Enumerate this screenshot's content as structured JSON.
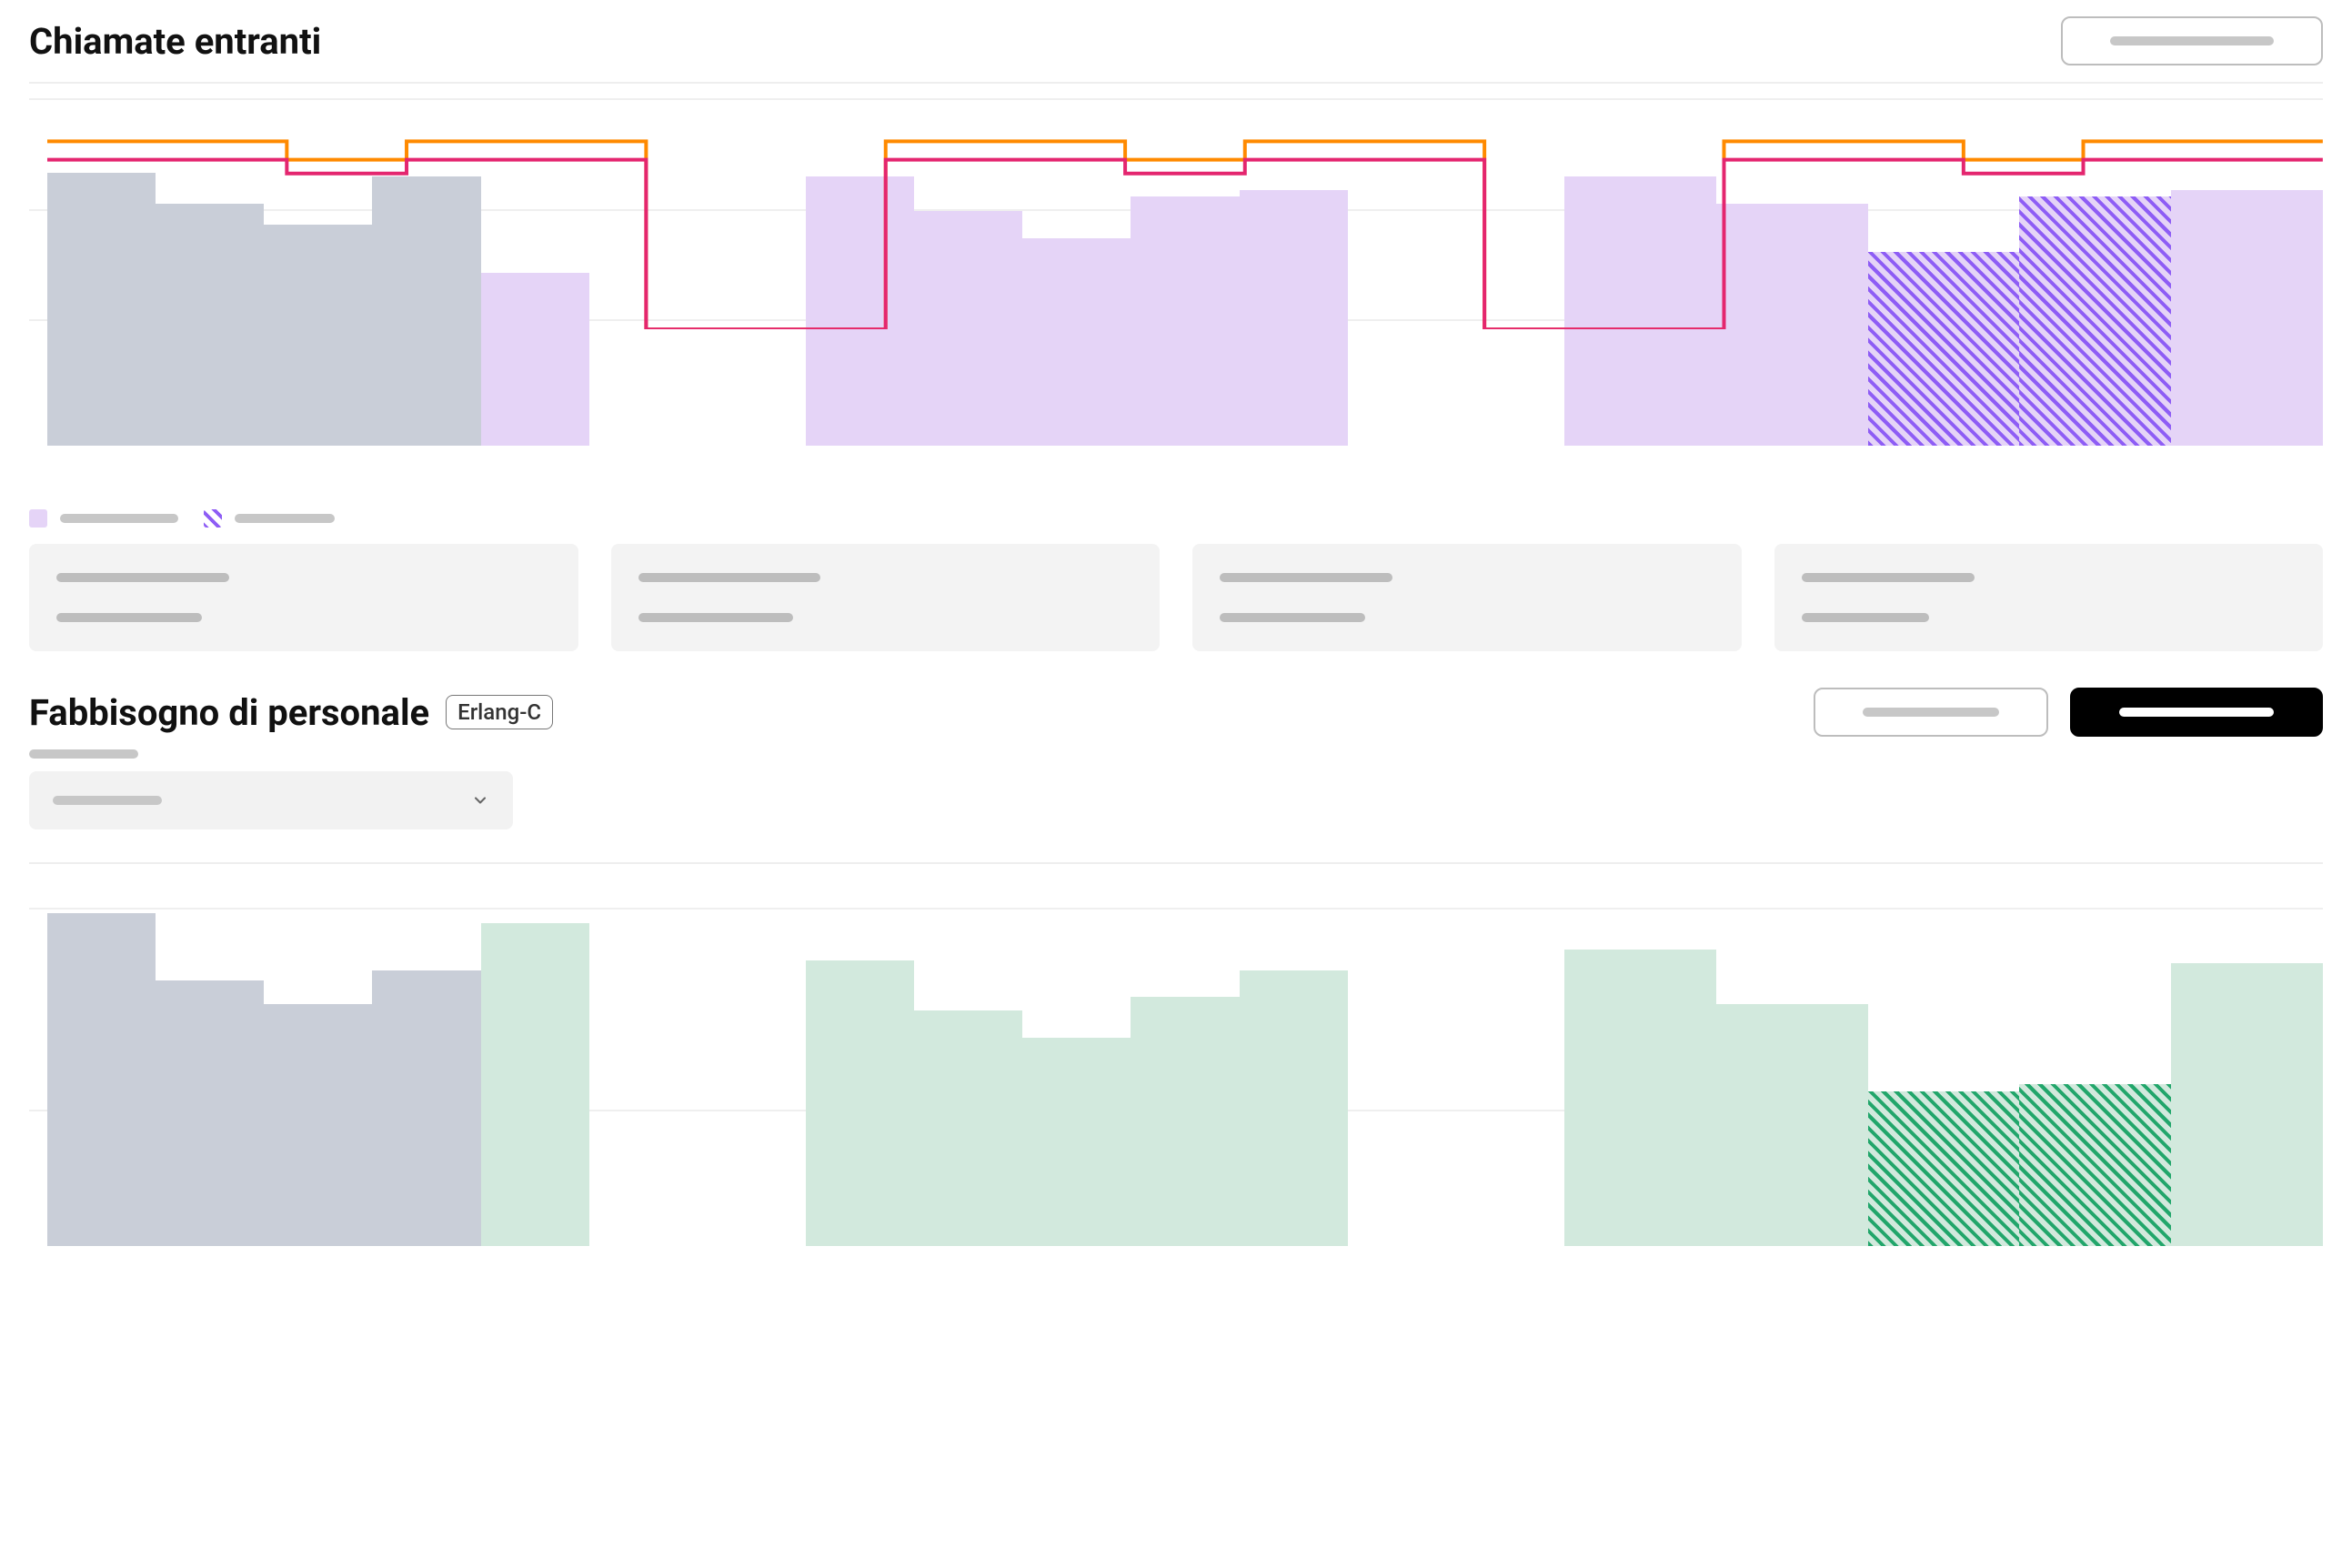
{
  "section1": {
    "title": "Chiamate entranti",
    "legend": [
      {
        "swatch": "lavender",
        "label": ""
      },
      {
        "swatch": "hatch-purple",
        "label": ""
      }
    ],
    "cards": [
      {},
      {},
      {},
      {}
    ]
  },
  "section2": {
    "title": "Fabbisogno di personale",
    "badge": "Erlang-C"
  },
  "chart_data": [
    {
      "type": "bar",
      "title": "Chiamate entranti",
      "notes": "Three day-groups, each with 5 interval bars. Day 1 first 4 bars are grey (history), rest lavender (forecast). Day 3 bars 4 and 5 are hatched purple overlay (adjustment). Two overlaid step-lines: orange (upper) and magenta/pink (lower), both drop to zero between day-groups.",
      "ylim": [
        0,
        100
      ],
      "gridlines_at": [
        36,
        68,
        100
      ],
      "groups": [
        {
          "name": "day1",
          "bars": [
            {
              "v": 79,
              "fill": "grey"
            },
            {
              "v": 70,
              "fill": "grey"
            },
            {
              "v": 64,
              "fill": "grey"
            },
            {
              "v": 78,
              "fill": "grey"
            },
            {
              "v": 50,
              "fill": "lavender"
            }
          ]
        },
        {
          "name": "day2",
          "bars": [
            {
              "v": 78,
              "fill": "lavender"
            },
            {
              "v": 68,
              "fill": "lavender"
            },
            {
              "v": 60,
              "fill": "lavender"
            },
            {
              "v": 72,
              "fill": "lavender"
            },
            {
              "v": 74,
              "fill": "lavender"
            }
          ]
        },
        {
          "name": "day3",
          "bars": [
            {
              "v": 78,
              "fill": "lavender"
            },
            {
              "v": 70,
              "fill": "lavender"
            },
            {
              "v": 56,
              "fill": "lavender",
              "hatch": 56
            },
            {
              "v": 72,
              "fill": "lavender",
              "hatch": 72
            },
            {
              "v": 74,
              "fill": "lavender"
            }
          ]
        }
      ],
      "series": [
        {
          "name": "orange_limit",
          "color": "#ff8a00",
          "values_per_group": [
            [
              82,
              82,
              74,
              82,
              82
            ],
            [
              82,
              82,
              74,
              82,
              82
            ],
            [
              82,
              82,
              74,
              82,
              82
            ]
          ],
          "between_groups": 0
        },
        {
          "name": "pink_limit",
          "color": "#e4266f",
          "values_per_group": [
            [
              74,
              74,
              68,
              74,
              74
            ],
            [
              74,
              74,
              68,
              74,
              74
            ],
            [
              74,
              74,
              68,
              74,
              74
            ]
          ],
          "between_groups": 0
        }
      ]
    },
    {
      "type": "bar",
      "title": "Fabbisogno di personale",
      "ylim": [
        0,
        100
      ],
      "gridlines_at": [
        40,
        100
      ],
      "groups": [
        {
          "name": "day1",
          "bars": [
            {
              "v": 99,
              "fill": "grey"
            },
            {
              "v": 79,
              "fill": "grey"
            },
            {
              "v": 72,
              "fill": "grey"
            },
            {
              "v": 82,
              "fill": "grey"
            },
            {
              "v": 96,
              "fill": "mint"
            }
          ]
        },
        {
          "name": "day2",
          "bars": [
            {
              "v": 85,
              "fill": "mint"
            },
            {
              "v": 70,
              "fill": "mint"
            },
            {
              "v": 62,
              "fill": "mint"
            },
            {
              "v": 74,
              "fill": "mint"
            },
            {
              "v": 82,
              "fill": "mint"
            }
          ]
        },
        {
          "name": "day3",
          "bars": [
            {
              "v": 88,
              "fill": "mint"
            },
            {
              "v": 72,
              "fill": "mint"
            },
            {
              "v": 46,
              "fill": "mint",
              "hatch": 46
            },
            {
              "v": 48,
              "fill": "mint",
              "hatch": 48
            },
            {
              "v": 84,
              "fill": "mint"
            }
          ]
        }
      ]
    }
  ]
}
